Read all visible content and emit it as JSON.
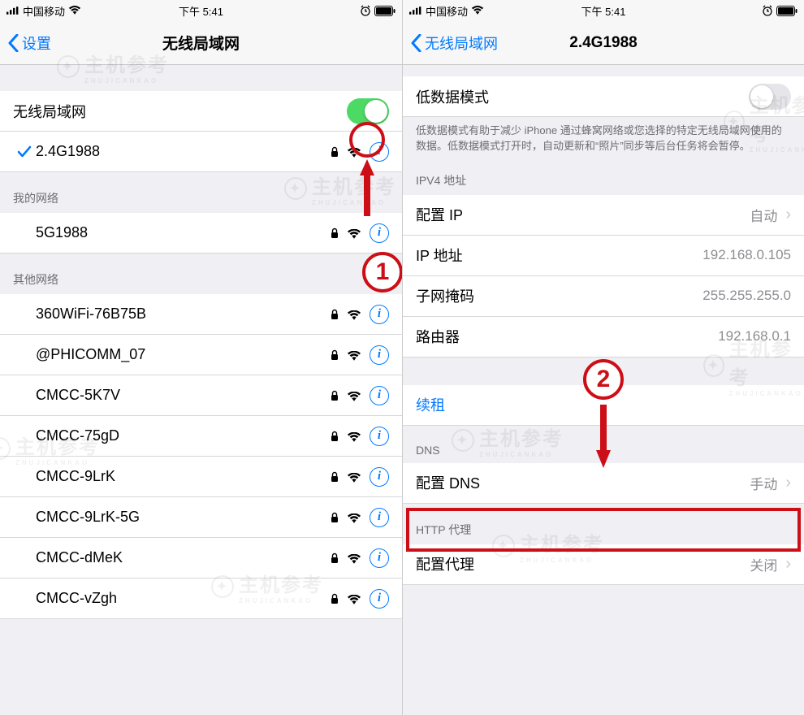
{
  "status": {
    "carrier": "中国移动",
    "time": "下午 5:41"
  },
  "left": {
    "back_label": "设置",
    "title": "无线局域网",
    "wifi_toggle_label": "无线局域网",
    "connected_ssid": "2.4G1988",
    "my_networks_header": "我的网络",
    "my_networks": [
      {
        "ssid": "5G1988"
      }
    ],
    "other_networks_header": "其他网络",
    "other_networks": [
      {
        "ssid": "360WiFi-76B75B"
      },
      {
        "ssid": "@PHICOMM_07"
      },
      {
        "ssid": "CMCC-5K7V"
      },
      {
        "ssid": "CMCC-75gD"
      },
      {
        "ssid": "CMCC-9LrK"
      },
      {
        "ssid": "CMCC-9LrK-5G"
      },
      {
        "ssid": "CMCC-dMeK"
      },
      {
        "ssid": "CMCC-vZgh"
      }
    ]
  },
  "right": {
    "back_label": "无线局域网",
    "title": "2.4G1988",
    "low_data_label": "低数据模式",
    "low_data_footer": "低数据模式有助于减少 iPhone 通过蜂窝网络或您选择的特定无线局域网使用的数据。低数据模式打开时，自动更新和“照片”同步等后台任务将会暂停。",
    "ipv4_header": "IPV4 地址",
    "config_ip_label": "配置 IP",
    "config_ip_value": "自动",
    "ip_label": "IP 地址",
    "ip_value": "192.168.0.105",
    "subnet_label": "子网掩码",
    "subnet_value": "255.255.255.0",
    "router_label": "路由器",
    "router_value": "192.168.0.1",
    "renew_label": "续租",
    "dns_header": "DNS",
    "config_dns_label": "配置 DNS",
    "config_dns_value": "手动",
    "http_header": "HTTP 代理",
    "config_proxy_label": "配置代理",
    "config_proxy_value": "关闭"
  },
  "watermark": {
    "text": "主机参考",
    "sub": "ZHUJICANKAO"
  },
  "annotations": {
    "step1": "1",
    "step2": "2"
  }
}
